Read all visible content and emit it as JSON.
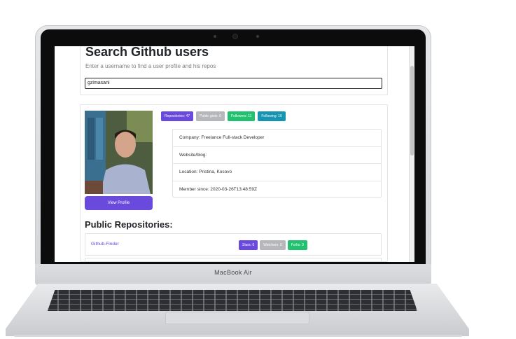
{
  "laptop": {
    "brand": "MacBook Air"
  },
  "search": {
    "title": "Search Github users",
    "subtitle": "Enter a username to find a user profile and his repos",
    "value": "gzimasani"
  },
  "profile": {
    "badges": [
      {
        "label": "Repositories: 47",
        "color": "#6a49dd"
      },
      {
        "label": "Public gists: 0",
        "color": "#b6b7ba"
      },
      {
        "label": "Followers: 11",
        "color": "#22c06f"
      },
      {
        "label": "Following: 10",
        "color": "#1694b1"
      }
    ],
    "details": [
      "Company: Freelance Full-stack Developer",
      "Website/blog:",
      "Location: Pristina, Kosovo",
      "Member since: 2020-03-26T13:48:59Z"
    ],
    "view_profile_label": "View Profile"
  },
  "repos": {
    "heading": "Public Repositories:",
    "items": [
      {
        "name": "Github-Finder",
        "stars": "Stars: 0",
        "watchers": "Watchers: 0",
        "forks": "Forks: 0"
      }
    ]
  }
}
